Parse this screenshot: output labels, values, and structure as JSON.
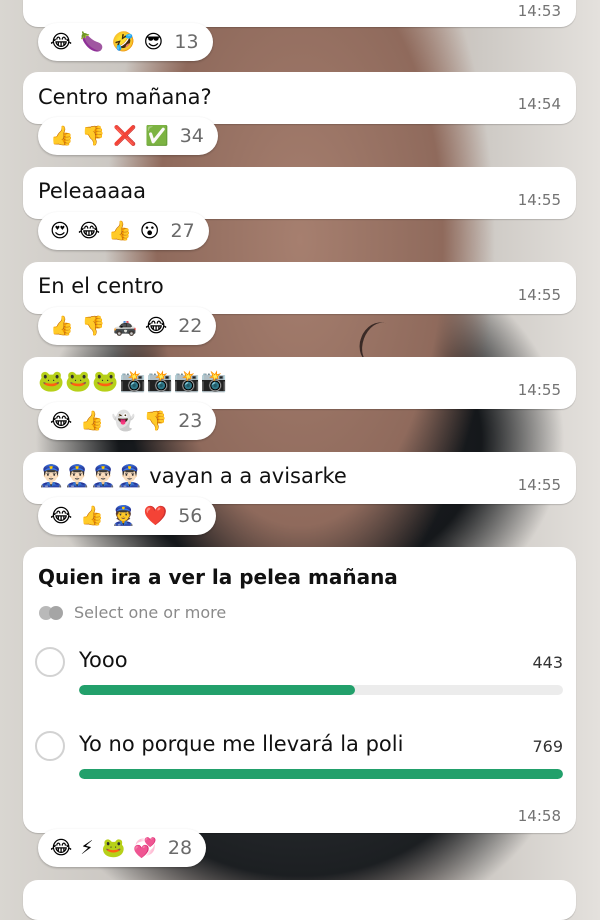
{
  "messages": [
    {
      "text": "",
      "time": "14:53",
      "reactions": [
        "😂",
        "🍆",
        "🤣",
        "😎"
      ],
      "count": "13"
    },
    {
      "text": "Centro mañana?",
      "time": "14:54",
      "reactions": [
        "👍",
        "👎",
        "❌",
        "✅"
      ],
      "count": "34"
    },
    {
      "text": "Peleaaaaa",
      "time": "14:55",
      "reactions": [
        "😍",
        "😂",
        "👍",
        "😮"
      ],
      "count": "27"
    },
    {
      "text": "En el centro",
      "time": "14:55",
      "reactions": [
        "👍",
        "👎",
        "🚓",
        "😂"
      ],
      "count": "22"
    },
    {
      "text": "🐸🐸🐸📸📸📸📸",
      "time": "14:55",
      "reactions": [
        "😂",
        "👍",
        "👻",
        "👎"
      ],
      "count": "23"
    },
    {
      "text": "👮🏻‍♂️👮🏻‍♂️👮🏻‍♂️👮🏻‍♂️ vayan a a avisarke",
      "time": "14:55",
      "reactions": [
        "😂",
        "👍",
        "👮",
        "❤️"
      ],
      "count": "56"
    }
  ],
  "poll": {
    "title": "Quien ira a ver la pelea mañana",
    "subtitle": "Select one or more",
    "options": [
      {
        "label": "Yooo",
        "votes": "443",
        "fraction": 0.57
      },
      {
        "label": "Yo no porque me llevará la poli",
        "votes": "769",
        "fraction": 1.0
      }
    ],
    "time": "14:58",
    "reactions": [
      "😂",
      "⚡",
      "🐸",
      "💞"
    ],
    "count": "28",
    "accent_color": "#22a06b"
  }
}
